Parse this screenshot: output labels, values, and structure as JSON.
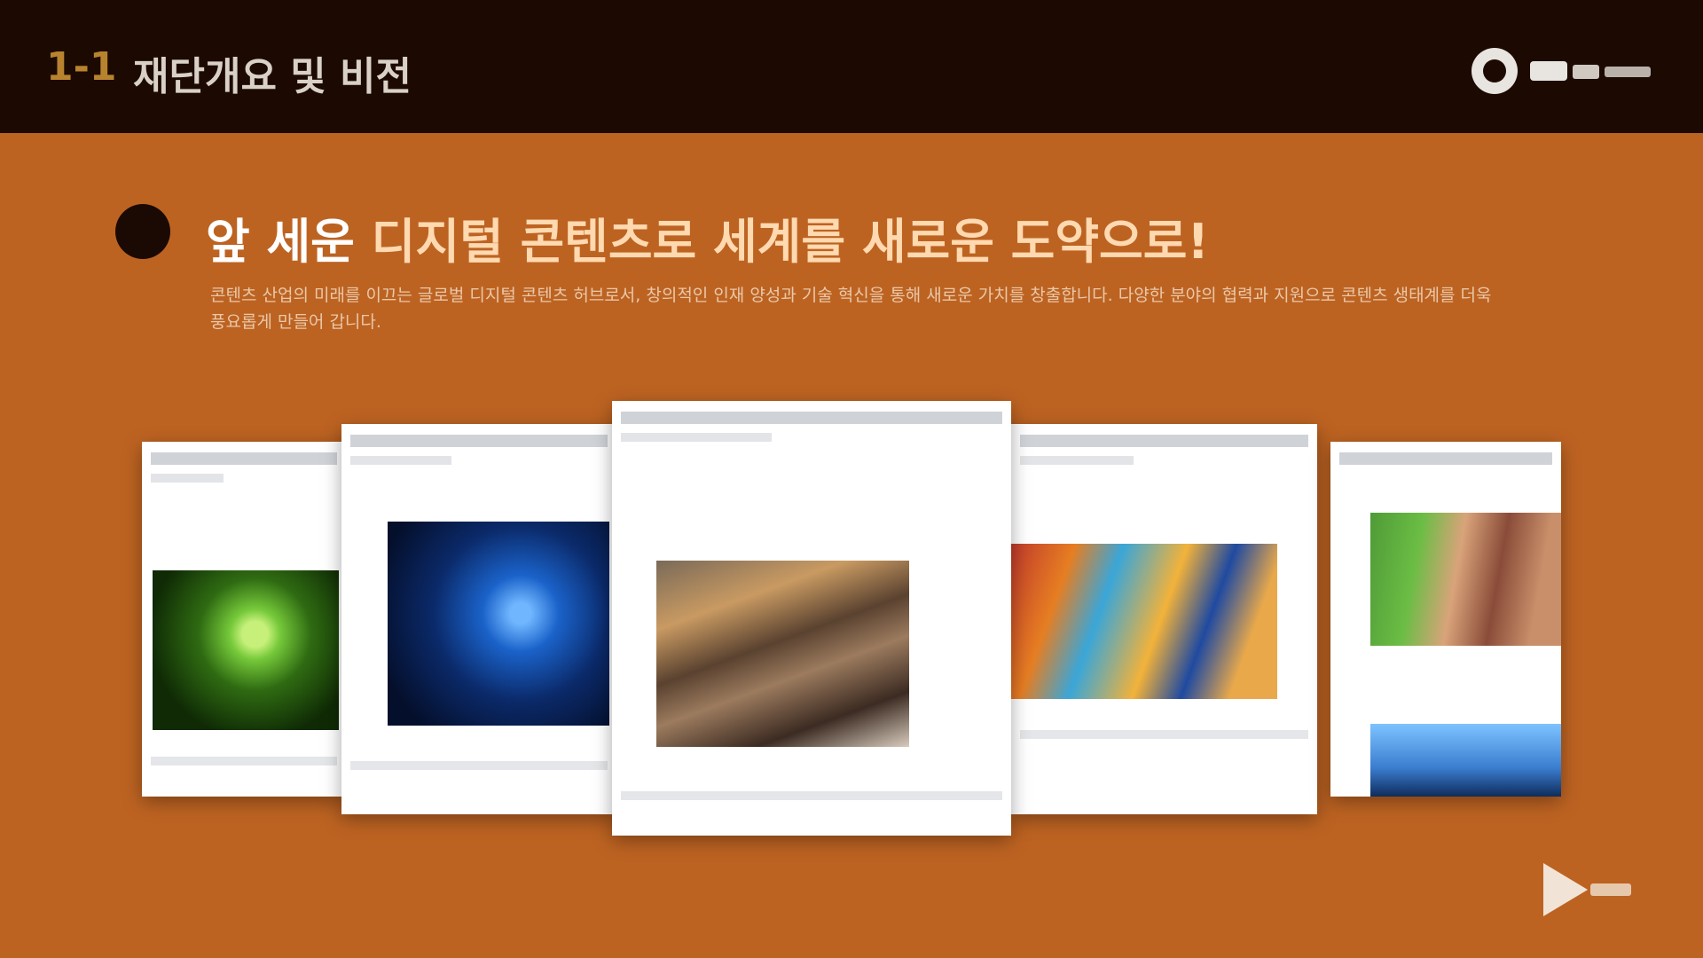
{
  "header": {
    "section_number": "1-1",
    "section_title": "재단개요 및 비전"
  },
  "main": {
    "headline_plain": "앞 세운 ",
    "headline_highlight": "디지털 콘텐츠로 세계를 새로운 도약으로!",
    "subtext": "콘텐츠 산업의 미래를 이끄는 글로벌 디지털 콘텐츠 허브로서, 창의적인 인재 양성과 기술 혁신을 통해 새로운 가치를 창출합니다. 다양한 분야의 협력과 지원으로 콘텐츠 생태계를 더욱 풍요롭게 만들어 갑니다."
  },
  "gallery": {
    "cards": [
      {
        "label": "green-screenshot"
      },
      {
        "label": "blue-screenshot"
      },
      {
        "label": "collage-screenshot"
      },
      {
        "label": "colorful-screenshot"
      },
      {
        "label": "map-screenshot"
      }
    ]
  },
  "colors": {
    "background": "#bd6322",
    "header_bg": "#1c0a02",
    "accent_gold": "#b8832e",
    "headline_highlight": "#ffd9b0"
  },
  "icons": {
    "logo": "brand-logo-icon",
    "bullet": "bullet-dot-icon",
    "corner": "play-logo-icon"
  }
}
